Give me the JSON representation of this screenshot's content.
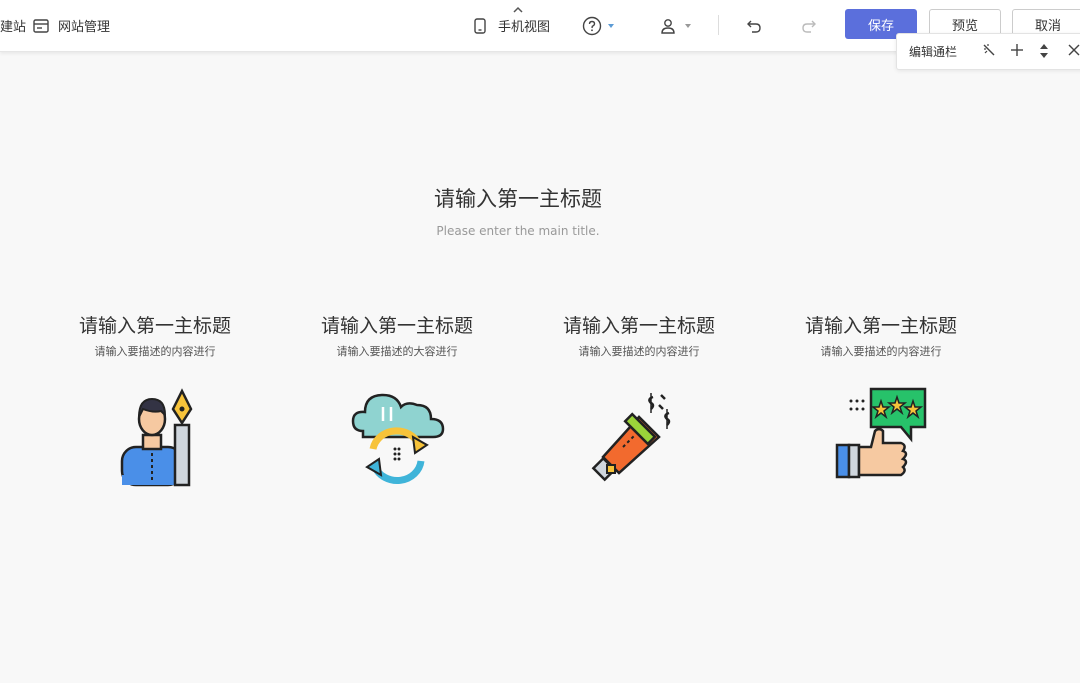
{
  "topbar": {
    "build_label": "建站",
    "site_manage_label": "网站管理",
    "mobile_view_label": "手机视图",
    "save_label": "保存",
    "preview_label": "预览",
    "cancel_label": "取消"
  },
  "edit_bar": {
    "label": "编辑通栏"
  },
  "hero": {
    "title": "请输入第一主标题",
    "subtitle": "Please enter the main title."
  },
  "features": [
    {
      "title": "请输入第一主标题",
      "desc": "请输入要描述的内容进行",
      "icon": "person-pen-icon"
    },
    {
      "title": "请输入第一主标题",
      "desc": "请输入要描述的大容进行",
      "icon": "cloud-sync-icon"
    },
    {
      "title": "请输入第一主标题",
      "desc": "请输入要描述的内容进行",
      "icon": "megaphone-icon"
    },
    {
      "title": "请输入第一主标题",
      "desc": "请输入要描述的内容进行",
      "icon": "thumbs-up-rating-icon"
    }
  ],
  "colors": {
    "primary": "#5b6fdc",
    "background": "#f8f8f8"
  }
}
